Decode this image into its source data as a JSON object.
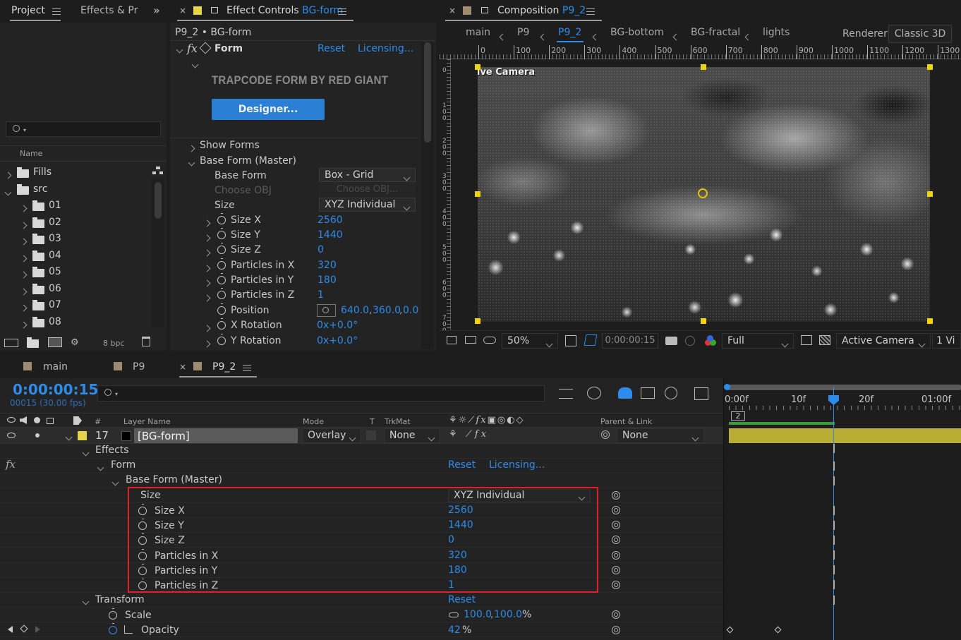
{
  "project_panel": {
    "tabs": [
      "Project",
      "Effects & Pr"
    ],
    "search_placeholder": "",
    "column_name": "Name",
    "items": [
      {
        "label": "Fills",
        "expanded": false,
        "indent": 0
      },
      {
        "label": "src",
        "expanded": true,
        "indent": 0
      },
      {
        "label": "01",
        "expanded": false,
        "indent": 1
      },
      {
        "label": "02",
        "expanded": false,
        "indent": 1
      },
      {
        "label": "03",
        "expanded": false,
        "indent": 1
      },
      {
        "label": "04",
        "expanded": false,
        "indent": 1
      },
      {
        "label": "05",
        "expanded": false,
        "indent": 1
      },
      {
        "label": "06",
        "expanded": false,
        "indent": 1
      },
      {
        "label": "07",
        "expanded": false,
        "indent": 1
      },
      {
        "label": "08",
        "expanded": false,
        "indent": 1
      }
    ],
    "bpc": "8 bpc"
  },
  "effect_controls": {
    "tab_label": "Effect Controls",
    "tab_layer": "BG-form",
    "breadcrumb": "P9_2 • BG-form",
    "effect_name": "Form",
    "reset": "Reset",
    "licensing": "Licensing...",
    "brand": "TRAPCODE FORM BY RED GIANT",
    "designer_button": "Designer...",
    "show_forms": "Show Forms",
    "base_form_master": "Base Form (Master)",
    "base_form_label": "Base Form",
    "base_form_value": "Box - Grid",
    "choose_obj_label": "Choose OBJ",
    "choose_obj_value": "Choose OBJ...",
    "size_label": "Size",
    "size_value": "XYZ Individual",
    "props": [
      {
        "label": "Size X",
        "value": "2560"
      },
      {
        "label": "Size Y",
        "value": "1440"
      },
      {
        "label": "Size Z",
        "value": "0"
      },
      {
        "label": "Particles in X",
        "value": "320"
      },
      {
        "label": "Particles in Y",
        "value": "180"
      },
      {
        "label": "Particles in Z",
        "value": "1"
      }
    ],
    "position_label": "Position",
    "position_x": "640.0",
    "position_y": "360.0",
    "position_z": "0.0",
    "x_rotation_label": "X Rotation",
    "x_rotation_value": "0x+0.0°",
    "y_rotation_label": "Y Rotation",
    "y_rotation_value": "0x+0.0°"
  },
  "composition": {
    "tab_label": "Composition",
    "tab_comp": "P9_2",
    "flow": [
      "main",
      "P9",
      "P9_2",
      "BG-bottom",
      "BG-fractal",
      "lights"
    ],
    "renderer_label": "Renderer:",
    "renderer_value": "Classic 3D",
    "ruler_labels": [
      "0",
      "100",
      "200",
      "300",
      "400",
      "500",
      "600",
      "700",
      "800",
      "900",
      "1000",
      "1100",
      "1200",
      "1300"
    ],
    "vruler_labels": [
      "0",
      "100",
      "200",
      "300",
      "400",
      "500",
      "600",
      "700"
    ],
    "viewer_label": "Active Camera",
    "zoom": "50%",
    "timecode": "0:00:00:15",
    "resolution": "Full",
    "camera": "Active Camera",
    "views": "1 Vi"
  },
  "timeline": {
    "tabs": [
      "main",
      "P9",
      "P9_2"
    ],
    "timecode": "0:00:00:15",
    "frame_info": "00015 (30.00 fps)",
    "columns": {
      "layer_name": "Layer Name",
      "mode": "Mode",
      "t": "T",
      "trkmat": "TrkMat",
      "parent": "Parent & Link",
      "num": "#"
    },
    "layer": {
      "num": "17",
      "name": "[BG-form]",
      "mode": "Overlay",
      "trkmat": "None",
      "parent": "None"
    },
    "effects_label": "Effects",
    "form_label": "Form",
    "reset": "Reset",
    "licensing": "Licensing...",
    "base_form_master": "Base Form (Master)",
    "size_label": "Size",
    "size_value": "XYZ Individual",
    "props": [
      {
        "label": "Size X",
        "value": "2560"
      },
      {
        "label": "Size Y",
        "value": "1440"
      },
      {
        "label": "Size Z",
        "value": "0"
      },
      {
        "label": "Particles in X",
        "value": "320"
      },
      {
        "label": "Particles in Y",
        "value": "180"
      },
      {
        "label": "Particles in Z",
        "value": "1"
      }
    ],
    "transform_label": "Transform",
    "transform_reset": "Reset",
    "scale_label": "Scale",
    "scale_x": "100.0",
    "scale_y": "100.0",
    "scale_unit": "%",
    "opacity_label": "Opacity",
    "opacity_value": "42",
    "opacity_unit": "%",
    "ruler": [
      "0:00f",
      "10f",
      "20f",
      "01:00f"
    ],
    "work_area_marker": "2"
  },
  "colors": {
    "accent": "#2d8ceb",
    "label_yellow": "#e6d34a",
    "highlight_box": "#e0202a"
  }
}
